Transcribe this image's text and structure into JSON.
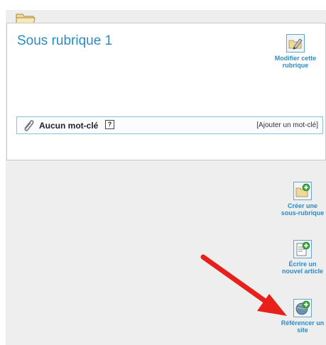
{
  "rubrique": {
    "title": "Sous rubrique 1",
    "edit_action": "Modifier cette rubrique"
  },
  "keywords": {
    "label": "Aucun mot-clé",
    "help": "?",
    "add_link": "[Ajouter un mot-clé]"
  },
  "actions": {
    "create_subsection": "Créer une sous-rubrique",
    "write_article": "Écrire un nouvel article",
    "reference_site": "Référencer un site"
  },
  "colors": {
    "link": "#2d8bc4",
    "arrow": "#e8201c",
    "panel": "#eeeeee"
  },
  "icons": [
    "folder-icon",
    "edit-folder-icon",
    "paperclip-icon",
    "help-icon",
    "new-subsection-icon",
    "new-article-icon",
    "add-site-icon",
    "arrow"
  ]
}
